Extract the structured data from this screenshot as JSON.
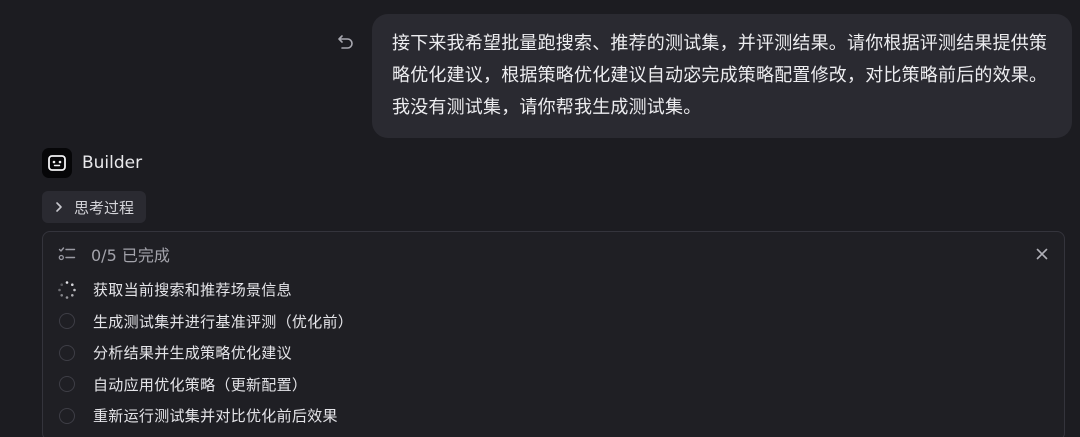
{
  "user_message": {
    "text": "接下来我希望批量跑搜索、推荐的测试集，并评测结果。请你根据评测结果提供策略优化建议，根据策略优化建议自动宓完成策略配置修改，对比策略前后的效果。我没有测试集，请你帮我生成测试集。"
  },
  "assistant": {
    "name": "Builder"
  },
  "thinking": {
    "label": "思考过程"
  },
  "task_panel": {
    "progress": "0/5 已完成",
    "completed": 0,
    "total": 5,
    "tasks": [
      {
        "label": "获取当前搜索和推荐场景信息",
        "status": "in-progress"
      },
      {
        "label": "生成测试集并进行基准评测（优化前）",
        "status": "pending"
      },
      {
        "label": "分析结果并生成策略优化建议",
        "status": "pending"
      },
      {
        "label": "自动应用优化策略（更新配置）",
        "status": "pending"
      },
      {
        "label": "重新运行测试集并对比优化前后效果",
        "status": "pending"
      }
    ]
  },
  "icons": {
    "undo": "undo-icon",
    "avatar": "bot-face-icon",
    "chevron": "chevron-right-icon",
    "checklist": "checklist-icon",
    "close": "close-icon",
    "spinner": "spinner-icon",
    "pending": "empty-circle-icon"
  },
  "colors": {
    "background": "#1c1c21",
    "bubble": "#2a2a31",
    "panel_border": "#34343c",
    "muted_text": "#a3a3ab"
  }
}
